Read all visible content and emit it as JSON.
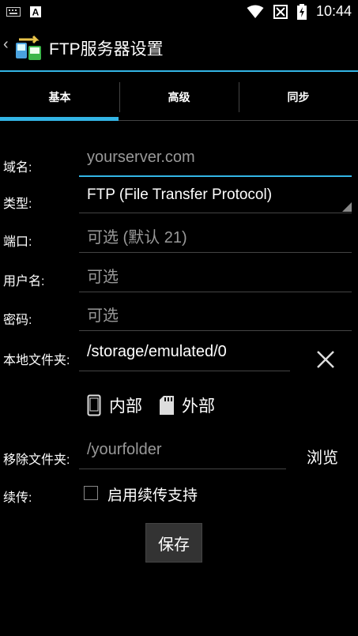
{
  "status_bar": {
    "time": "10:44",
    "icons": [
      "keyboard-icon",
      "a-text-icon",
      "wifi-icon",
      "no-signal-icon",
      "battery-charging-icon"
    ]
  },
  "action_bar": {
    "title": "FTP服务器设置",
    "accent": "#33b5e5"
  },
  "tabs": [
    {
      "label": "基本",
      "selected": true
    },
    {
      "label": "高级",
      "selected": false
    },
    {
      "label": "同步",
      "selected": false
    }
  ],
  "form": {
    "domain": {
      "label": "域名:",
      "placeholder": "yourserver.com"
    },
    "type": {
      "label": "类型:",
      "value": "FTP (File Transfer Protocol)"
    },
    "port": {
      "label": "端口:",
      "placeholder": "可选 (默认 21)"
    },
    "username": {
      "label": "用户名:",
      "placeholder": "可选"
    },
    "password": {
      "label": "密码:",
      "placeholder": "可选"
    },
    "local_folder": {
      "label": "本地文件夹:",
      "value": "/storage/emulated/0"
    },
    "storage": {
      "internal": "内部",
      "external": "外部"
    },
    "remote_folder": {
      "label": "移除文件夹:",
      "placeholder": "/yourfolder",
      "browse": "浏览"
    },
    "resume": {
      "label": "续传:",
      "checkbox_label": "启用续传支持",
      "checked": false
    },
    "save": "保存"
  }
}
